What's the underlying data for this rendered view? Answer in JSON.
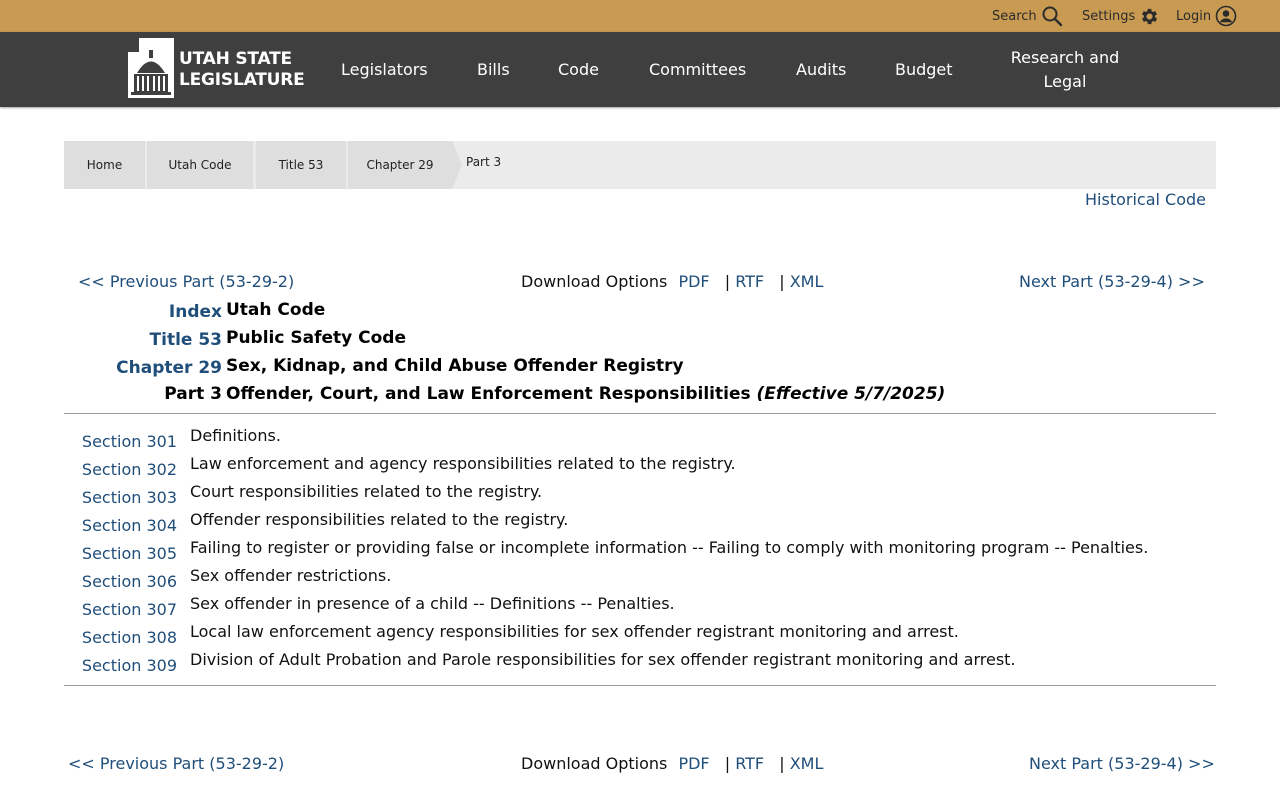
{
  "utility": {
    "search_label": "Search",
    "settings_label": "Settings",
    "login_label": "Login"
  },
  "logo": {
    "line1": "UTAH STATE",
    "line2": "LEGISLATURE"
  },
  "nav": {
    "legislators": "Legislators",
    "bills": "Bills",
    "code": "Code",
    "committees": "Committees",
    "audits": "Audits",
    "budget": "Budget",
    "research_line1": "Research and",
    "research_line2": "Legal"
  },
  "breadcrumb": {
    "home": "Home",
    "utah_code": "Utah Code",
    "title": "Title 53",
    "chapter": "Chapter 29",
    "part": "Part 3"
  },
  "historical_code": "Historical Code",
  "pager": {
    "prev": "<< Previous Part (53-29-2)",
    "next": "Next Part (53-29-4) >>",
    "download_label": "Download Options",
    "pdf": "PDF",
    "rtf": "RTF",
    "xml": "XML",
    "sep": "|"
  },
  "heading": {
    "index_label": "Index",
    "index_title": "Utah Code",
    "title_label": "Title 53",
    "title_title": "Public Safety Code",
    "chapter_label": "Chapter 29",
    "chapter_title": "Sex, Kidnap, and Child Abuse Offender Registry",
    "part_label": "Part 3",
    "part_title": "Offender, Court, and Law Enforcement Responsibilities",
    "part_effective": "(Effective 5/7/2025)"
  },
  "sections": [
    {
      "label": "Section 301",
      "desc": "Definitions."
    },
    {
      "label": "Section 302",
      "desc": "Law enforcement and agency responsibilities related to the registry."
    },
    {
      "label": "Section 303",
      "desc": "Court responsibilities related to the registry."
    },
    {
      "label": "Section 304",
      "desc": "Offender responsibilities related to the registry."
    },
    {
      "label": "Section 305",
      "desc": "Failing to register or providing false or incomplete information -- Failing to comply with monitoring program -- Penalties."
    },
    {
      "label": "Section 306",
      "desc": "Sex offender restrictions."
    },
    {
      "label": "Section 307",
      "desc": "Sex offender in presence of a child -- Definitions -- Penalties."
    },
    {
      "label": "Section 308",
      "desc": "Local law enforcement agency responsibilities for sex offender registrant monitoring and arrest."
    },
    {
      "label": "Section 309",
      "desc": "Division of Adult Probation and Parole responsibilities for sex offender registrant monitoring and arrest."
    }
  ],
  "colors": {
    "utility_bar": "#c99b52",
    "nav_bar": "#3f3f3f",
    "link": "#1f4e7a"
  }
}
